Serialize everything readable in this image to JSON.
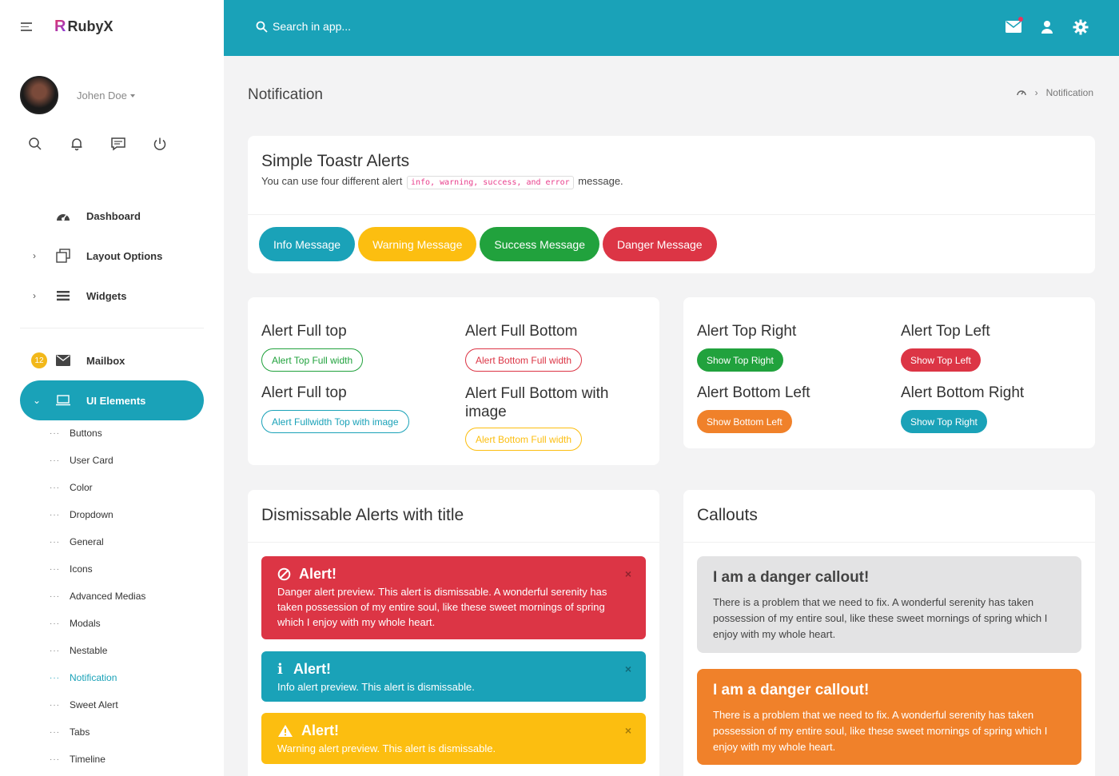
{
  "brand": {
    "name": "RubyX",
    "logo_letter": "R"
  },
  "user": {
    "name": "Johen Doe"
  },
  "sidebar": {
    "nav": [
      {
        "label": "Dashboard",
        "icon": "dashboard-icon"
      },
      {
        "label": "Layout Options",
        "icon": "layout-icon"
      },
      {
        "label": "Widgets",
        "icon": "list-icon"
      }
    ],
    "mailbox": {
      "label": "Mailbox",
      "badge": "12"
    },
    "ui_elements": {
      "label": "UI Elements"
    },
    "sub_items": [
      {
        "label": "Buttons"
      },
      {
        "label": "User Card"
      },
      {
        "label": "Color"
      },
      {
        "label": "Dropdown"
      },
      {
        "label": "General"
      },
      {
        "label": "Icons"
      },
      {
        "label": "Advanced Medias"
      },
      {
        "label": "Modals"
      },
      {
        "label": "Nestable"
      },
      {
        "label": "Notification"
      },
      {
        "label": "Sweet Alert"
      },
      {
        "label": "Tabs"
      },
      {
        "label": "Timeline"
      }
    ]
  },
  "header": {
    "search_placeholder": "Search in app..."
  },
  "page": {
    "title": "Notification",
    "breadcrumb_current": "Notification"
  },
  "toastr": {
    "title": "Simple Toastr Alerts",
    "desc_before": "You can use four different alert",
    "desc_code": "info, warning, success, and error",
    "desc_after": "message.",
    "buttons": {
      "info": "Info Message",
      "warning": "Warning Message",
      "success": "Success Message",
      "danger": "Danger Message"
    }
  },
  "full_alerts": {
    "top_title": "Alert Full top",
    "top_btn": "Alert Top Full width",
    "bottom_title": "Alert Full Bottom",
    "bottom_btn": "Alert Bottom Full width",
    "top_img_title": "Alert Full top",
    "top_img_btn": "Alert Fullwidth Top with image",
    "bottom_img_title": "Alert Full Bottom with image",
    "bottom_img_btn": "Alert Bottom Full width"
  },
  "corner_alerts": {
    "top_right_title": "Alert Top Right",
    "top_right_btn": "Show Top Right",
    "top_left_title": "Alert Top Left",
    "top_left_btn": "Show Top Left",
    "bottom_left_title": "Alert Bottom Left",
    "bottom_left_btn": "Show Bottom Left",
    "bottom_right_title": "Alert Bottom Right",
    "bottom_right_btn": "Show Top Right"
  },
  "dismissable": {
    "title": "Dismissable Alerts with title",
    "danger": {
      "title": "Alert!",
      "text": "Danger alert preview. This alert is dismissable. A wonderful serenity has taken possession of my entire soul, like these sweet mornings of spring which I enjoy with my whole heart."
    },
    "info": {
      "title": "Alert!",
      "text": "Info alert preview. This alert is dismissable."
    },
    "warning": {
      "title": "Alert!",
      "text": "Warning alert preview. This alert is dismissable."
    },
    "close_glyph": "×"
  },
  "callouts": {
    "title": "Callouts",
    "gray": {
      "title": "I am a danger callout!",
      "text": "There is a problem that we need to fix. A wonderful serenity has taken possession of my entire soul, like these sweet mornings of spring which I enjoy with my whole heart."
    },
    "orange": {
      "title": "I am a danger callout!",
      "text": "There is a problem that we need to fix. A wonderful serenity has taken possession of my entire soul, like these sweet mornings of spring which I enjoy with my whole heart."
    }
  },
  "colors": {
    "primary": "#1aa2b8",
    "warning": "#fcbe10",
    "success": "#21a23d",
    "danger": "#dc3545",
    "orange": "#f0812a",
    "badge": "#f2b81a"
  }
}
